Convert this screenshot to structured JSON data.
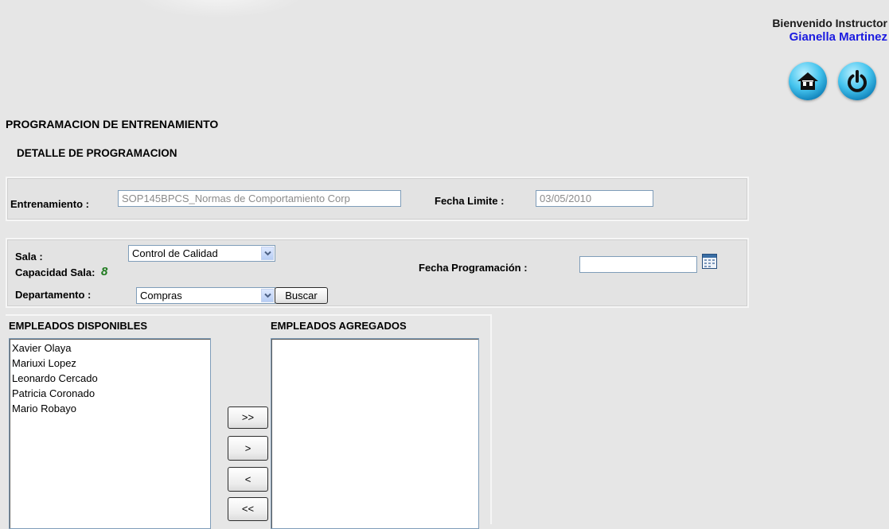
{
  "header": {
    "welcome_text": "Bienvenido Instructor",
    "user_name": "Gianella Martinez",
    "home_icon": "home-icon",
    "power_icon": "power-icon"
  },
  "page": {
    "title": "PROGRAMACION DE ENTRENAMIENTO",
    "section_title": "DETALLE DE PROGRAMACION"
  },
  "training": {
    "label": "Entrenamiento :",
    "value": "SOP145BPCS_Normas de Comportamiento Corp",
    "deadline_label": "Fecha Limite :",
    "deadline_value": "03/05/2010"
  },
  "filters": {
    "room_label": "Sala :",
    "room_value": "Control de Calidad",
    "capacity_label": "Capacidad Sala:",
    "capacity_value": "8",
    "department_label": "Departamento :",
    "department_value": "Compras",
    "search_button": "Buscar",
    "schedule_date_label": "Fecha Programación :",
    "schedule_date_value": "",
    "calendar_icon": "calendar-icon"
  },
  "employees": {
    "available_title": "EMPLEADOS DISPONIBLES",
    "added_title": "EMPLEADOS AGREGADOS",
    "available": [
      "Xavier Olaya",
      "Mariuxi Lopez",
      "Leonardo Cercado",
      "Patricia Coronado",
      "Mario Robayo"
    ],
    "added": [],
    "buttons": {
      "add_all": ">>",
      "add_one": ">",
      "remove_one": "<",
      "remove_all": "<<"
    }
  },
  "colors": {
    "background": "#e6e6e6",
    "user_name": "#1a1ae0",
    "capacity_value": "#1e7a1e",
    "icon_blue": "#1a95d0"
  }
}
